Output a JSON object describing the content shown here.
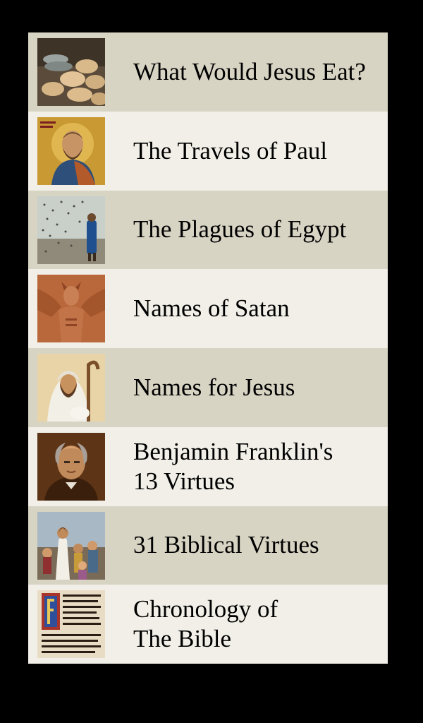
{
  "colors": {
    "background": "#000000",
    "row_dark": "#d8d4c4",
    "row_light": "#f1efe7",
    "text": "#000000"
  },
  "menu": {
    "items": [
      {
        "label": "What Would Jesus Eat?",
        "image": "bread-and-fish-image"
      },
      {
        "label": "The Travels of Paul",
        "image": "saint-paul-icon-image"
      },
      {
        "label": "The Plagues of Egypt",
        "image": "locust-plague-image"
      },
      {
        "label": "Names of Satan",
        "image": "satan-carving-image"
      },
      {
        "label": "Names for Jesus",
        "image": "jesus-shepherd-image"
      },
      {
        "label": "Benjamin Franklin's\n13 Virtues",
        "image": "benjamin-franklin-portrait-image"
      },
      {
        "label": "31 Biblical Virtues",
        "image": "jesus-with-children-image"
      },
      {
        "label": "Chronology of\nThe Bible",
        "image": "illuminated-manuscript-image"
      }
    ]
  }
}
